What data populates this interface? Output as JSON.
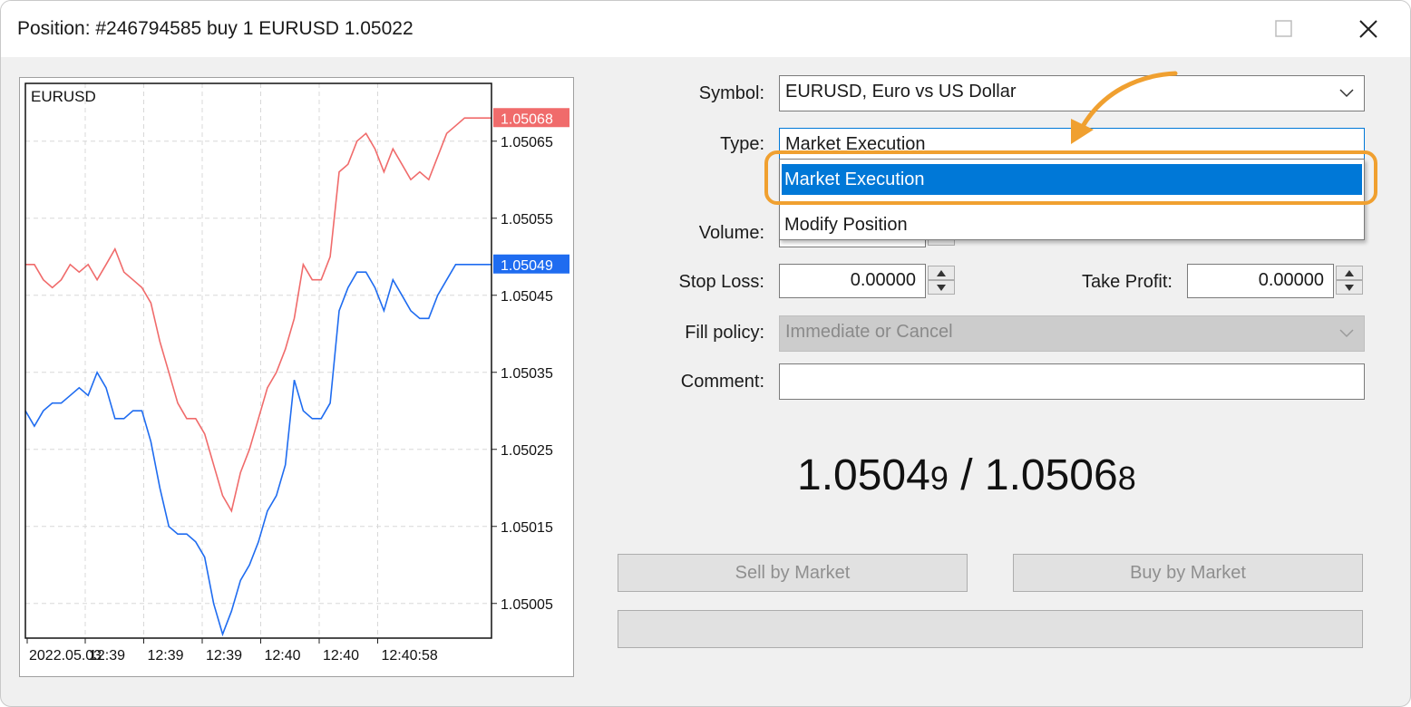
{
  "window": {
    "title": "Position: #246794585 buy 1 EURUSD 1.05022"
  },
  "chart": {
    "symbol": "EURUSD",
    "y_tick_labels": [
      "1.05065",
      "1.05055",
      "1.05045",
      "1.05035",
      "1.05025",
      "1.05015",
      "1.05005"
    ],
    "x_tick_labels": [
      "2022.05.03",
      "12:39",
      "12:39",
      "12:39",
      "12:40",
      "12:40",
      "12:40:58"
    ],
    "ask_label": "1.05068",
    "bid_label": "1.05049",
    "ask_color": "#f06b6b",
    "bid_color": "#1f6cf0"
  },
  "chart_data": {
    "type": "line",
    "ylim": [
      1.050005,
      1.050725
    ],
    "series": [
      {
        "color": "#f06b6b",
        "values": [
          1.05049,
          1.05049,
          1.05047,
          1.05046,
          1.05047,
          1.05049,
          1.05048,
          1.05049,
          1.05047,
          1.05049,
          1.05051,
          1.05048,
          1.05047,
          1.05046,
          1.05044,
          1.05039,
          1.05035,
          1.05031,
          1.05029,
          1.05029,
          1.05027,
          1.05023,
          1.05019,
          1.05017,
          1.05022,
          1.05025,
          1.05029,
          1.05033,
          1.05035,
          1.05038,
          1.05042,
          1.05049,
          1.05047,
          1.05047,
          1.0505,
          1.05061,
          1.05062,
          1.05065,
          1.05066,
          1.05064,
          1.05061,
          1.05064,
          1.05062,
          1.0506,
          1.05061,
          1.0506,
          1.05063,
          1.05066,
          1.05067,
          1.05068,
          1.05068,
          1.05068,
          1.05068
        ]
      },
      {
        "color": "#1f6cf0",
        "values": [
          1.0503,
          1.05028,
          1.0503,
          1.05031,
          1.05031,
          1.05032,
          1.05033,
          1.05032,
          1.05035,
          1.05033,
          1.05029,
          1.05029,
          1.0503,
          1.0503,
          1.05026,
          1.0502,
          1.05015,
          1.05014,
          1.05014,
          1.05013,
          1.05011,
          1.05005,
          1.05001,
          1.05004,
          1.05008,
          1.0501,
          1.05013,
          1.05017,
          1.05019,
          1.05023,
          1.05034,
          1.0503,
          1.05029,
          1.05029,
          1.05031,
          1.05043,
          1.05046,
          1.05048,
          1.05048,
          1.05046,
          1.05043,
          1.05047,
          1.05045,
          1.05043,
          1.05042,
          1.05042,
          1.05045,
          1.05047,
          1.05049,
          1.05049,
          1.05049,
          1.05049,
          1.05049
        ]
      }
    ],
    "xlabel": "",
    "ylabel": "",
    "grid": true
  },
  "form": {
    "symbol_label": "Symbol:",
    "symbol_value": "EURUSD, Euro vs US Dollar",
    "type_label": "Type:",
    "type_value": "Market Execution",
    "volume_label": "Volume:",
    "stop_loss_label": "Stop Loss:",
    "stop_loss_value": "0.00000",
    "take_profit_label": "Take Profit:",
    "take_profit_value": "0.00000",
    "fill_policy_label": "Fill policy:",
    "fill_policy_value": "Immediate or Cancel",
    "comment_label": "Comment:",
    "comment_value": ""
  },
  "dropdown": {
    "options": [
      "Market Execution",
      "Modify Position"
    ],
    "selected": "Market Execution",
    "highlight_color": "#f0a030"
  },
  "quote": {
    "bid_main": "1.0504",
    "bid_pip": "9",
    "separator": "/",
    "ask_main": "1.0506",
    "ask_pip": "8"
  },
  "buttons": {
    "sell": "Sell by Market",
    "buy": "Buy by Market",
    "status": ""
  }
}
